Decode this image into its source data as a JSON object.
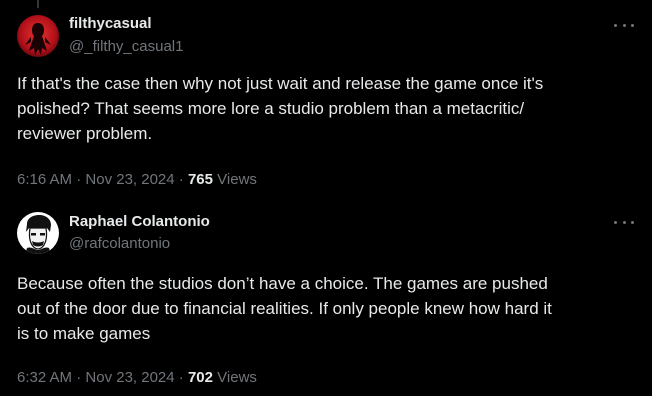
{
  "tweets": [
    {
      "display_name": "filthycasual",
      "handle": "@_filthy_casual1",
      "text": "If that's the case then why not just wait and release the game once it's\npolished? That seems more lore a studio problem than a metacritic/\nreviewer problem.",
      "time": "6:16 AM",
      "separator": "·",
      "date": "Nov 23, 2024",
      "views_count": "765",
      "views_label": "Views",
      "avatar_color": "#c0141a"
    },
    {
      "display_name": "Raphael Colantonio",
      "handle": "@rafcolantonio",
      "text": "Because often the studios don’t have a choice. The games are pushed\nout of the door due to financial realities. If only people knew how hard it\nis to make games",
      "time": "6:32 AM",
      "separator": "·",
      "date": "Nov 23, 2024",
      "views_count": "702",
      "views_label": "Views",
      "avatar_color": "#ffffff"
    }
  ],
  "colors": {
    "background": "#000000",
    "primary_text": "#e7e9ea",
    "secondary_text": "#71767b",
    "thread_line": "#333639"
  },
  "icons": {
    "more": "more-horizontal-icon"
  }
}
